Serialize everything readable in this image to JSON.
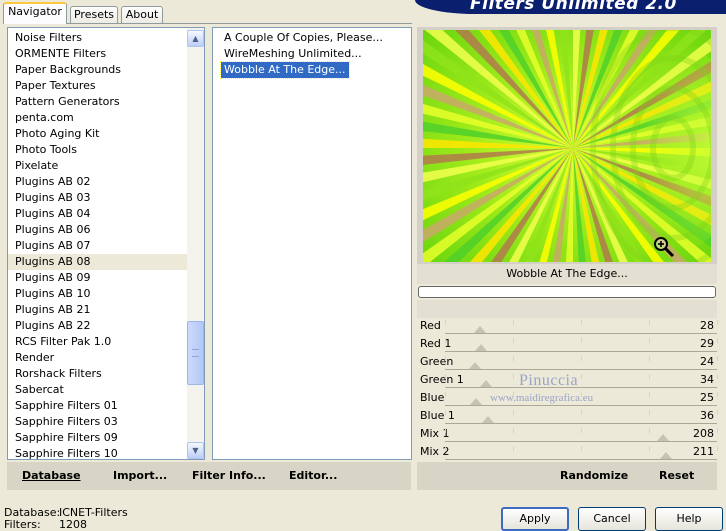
{
  "tabs": [
    {
      "label": "Navigator",
      "active": true
    },
    {
      "label": "Presets",
      "active": false
    },
    {
      "label": "About",
      "active": false
    }
  ],
  "app_title": "Filters Unlimited 2.0",
  "categories": [
    "Noise Filters",
    "ORMENTE Filters",
    "Paper Backgrounds",
    "Paper Textures",
    "Pattern Generators",
    "penta.com",
    "Photo Aging Kit",
    "Photo Tools",
    "Pixelate",
    "Plugins AB 02",
    "Plugins AB 03",
    "Plugins AB 04",
    "Plugins AB 06",
    "Plugins AB 07",
    "Plugins AB 08",
    "Plugins AB 09",
    "Plugins AB 10",
    "Plugins AB 21",
    "Plugins AB 22",
    "RCS Filter Pak 1.0",
    "Render",
    "Rorshack Filters",
    "Sabercat",
    "Sapphire Filters 01",
    "Sapphire Filters 03",
    "Sapphire Filters 09",
    "Sapphire Filters 10"
  ],
  "selected_category": "Plugins AB 08",
  "filters": [
    "A Couple Of Copies, Please...",
    "WireMeshing Unlimited...",
    "Wobble At The Edge..."
  ],
  "selected_filter": "Wobble At The Edge...",
  "preview": {
    "filter_name": "Wobble At The Edge...",
    "zoom_icon": "magnifier-plus-icon"
  },
  "sliders": [
    {
      "label": "Red",
      "value": "28",
      "level": 0.11
    },
    {
      "label": "Red 1",
      "value": "29",
      "level": 0.114
    },
    {
      "label": "Green",
      "value": "24",
      "level": 0.094
    },
    {
      "label": "Green 1",
      "value": "34",
      "level": 0.133
    },
    {
      "label": "Blue",
      "value": "25",
      "level": 0.098
    },
    {
      "label": "Blue 1",
      "value": "36",
      "level": 0.141
    },
    {
      "label": "Mix 1",
      "value": "208",
      "level": 0.816
    },
    {
      "label": "Mix 2",
      "value": "211",
      "level": 0.827
    }
  ],
  "watermark": {
    "name": "Pinuccia",
    "site": "www.maidiregrafica.eu"
  },
  "left_toolbar": {
    "database": "Database",
    "import": "Import...",
    "filter_info": "Filter Info...",
    "editor": "Editor..."
  },
  "right_toolbar": {
    "randomize": "Randomize",
    "reset": "Reset"
  },
  "status": {
    "db_label": "Database:",
    "db_value": "ICNET-Filters",
    "filters_label": "Filters:",
    "filters_value": "1208"
  },
  "buttons": {
    "apply": "Apply",
    "cancel": "Cancel",
    "help": "Help"
  },
  "colors": {
    "selection": "#316ac5",
    "banner": "#0a1f6e"
  }
}
